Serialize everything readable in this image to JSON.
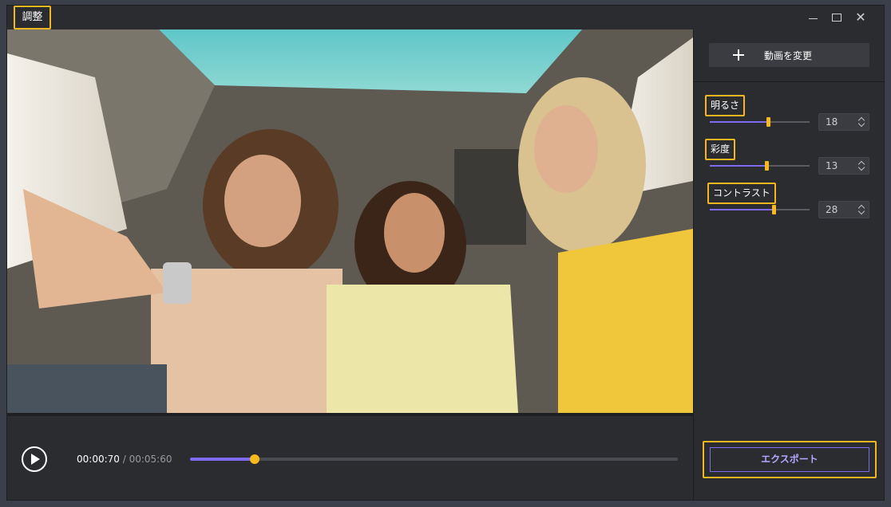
{
  "window": {
    "title": "調整"
  },
  "window_controls": {
    "minimize_icon": "minimize-icon",
    "maximize_icon": "maximize-icon",
    "close_icon": "close-icon",
    "close_glyph": "✕"
  },
  "player": {
    "current_time": "00:00:70",
    "separator": " / ",
    "total_time": "00:05:60",
    "progress": 0.132,
    "play_icon": "play-icon"
  },
  "sidebar": {
    "change_video_label": "動画を変更",
    "adjustments": [
      {
        "label": "明るさ",
        "value": "18",
        "fraction": 0.58
      },
      {
        "label": "彩度",
        "value": "13",
        "fraction": 0.57
      },
      {
        "label": "コントラスト",
        "value": "28",
        "fraction": 0.64
      }
    ],
    "export_label": "エクスポート"
  },
  "colors": {
    "accent": "#7d6cf0",
    "thumb": "#f7b81e",
    "highlight": "#f2b61e",
    "background": "#2b2c30"
  }
}
